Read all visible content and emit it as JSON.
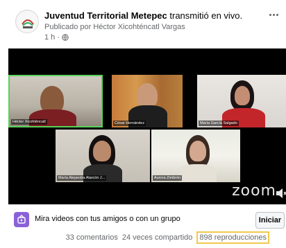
{
  "post": {
    "page_name": "Juventud Territorial Metepec",
    "action": "transmitió en vivo.",
    "byline": "Publicado por Héctor Xicohténcatl Vargas",
    "time": "1 h",
    "separator": "·",
    "audience_icon": "globe-icon",
    "more_icon": "more-options-icon"
  },
  "video": {
    "participants": [
      {
        "name": "Héctor Xicohténcatl"
      },
      {
        "name": "César Hernández"
      },
      {
        "name": "María García Salgado"
      },
      {
        "name": "María Alejandra Alarcón J..."
      },
      {
        "name": "Aurora Zimbrón"
      }
    ],
    "watermark": "zoom"
  },
  "watch_together": {
    "text": "Mira videos con tus amigos o con un grupo",
    "button": "Iniciar"
  },
  "stats": {
    "comments": "33 comentarios",
    "shares": "24 veces compartido",
    "views": "898 reproducciones"
  },
  "colors": {
    "highlight": "#f2c94c",
    "active_speaker": "#5ad25a",
    "watch_icon_bg": "#8a62d8"
  }
}
